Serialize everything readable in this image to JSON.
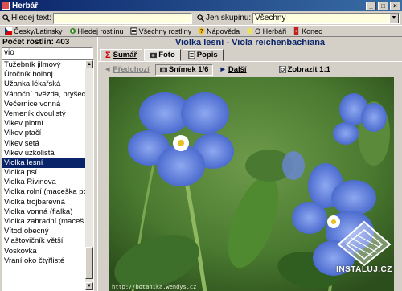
{
  "window": {
    "title": "Herbář"
  },
  "search": {
    "text_label": "Hledej text:",
    "text_value": "",
    "group_label": "Jen skupinu:",
    "group_value": "Všechny"
  },
  "toolbar": {
    "items": [
      {
        "label": "Česky/Latinsky",
        "icon": "language-icon"
      },
      {
        "label": "Hledej rostlinu",
        "icon": "search-plant-icon"
      },
      {
        "label": "Všechny rostliny",
        "icon": "all-plants-icon"
      },
      {
        "label": "Nápověda",
        "icon": "help-icon"
      },
      {
        "label": "O Herbáři",
        "icon": "about-icon"
      },
      {
        "label": "Konec",
        "icon": "exit-icon"
      }
    ]
  },
  "left": {
    "count_label": "Počet rostlin: 403",
    "filter_value": "vio",
    "items": [
      "Tužebník jilmový",
      "Úročník bolhoj",
      "Užanka lékařská",
      "Vánoční hvězda, pryšec (",
      "Večernice vonná",
      "Vemeník dvoulistý",
      "Vikev plotní",
      "Vikev ptačí",
      "Vikev setá",
      "Vikev úzkolistá",
      "Violka lesní",
      "Violka psí",
      "Violka Rivinova",
      "Violka rolní (maceška pol",
      "Violka trojbarevná",
      "Violka vonná (fialka)",
      "Violka zahradní (maceš",
      "Vítod obecný",
      "Vlaštovičník větší",
      "Voskovka",
      "Vraní  oko čtyřlisté"
    ],
    "selected_index": 10
  },
  "right": {
    "plant_title": "Violka lesní - Viola reichenbachiana",
    "tabs": [
      "Sumář",
      "Foto",
      "Popis"
    ],
    "active_tab": "Foto",
    "nav": {
      "prev": "Předchozí",
      "counter": "Snímek 1/6",
      "next": "Další",
      "zoom": "Zobrazit 1:1"
    },
    "photo_watermark": "http://botanika.wendys.cz"
  },
  "logo": {
    "text": "INSTALUJ.CZ"
  },
  "colors": {
    "titlebar": "#0a246a",
    "selection": "#0a246a",
    "input_bg": "#ffffe0",
    "flower": "#5a7fd8"
  }
}
